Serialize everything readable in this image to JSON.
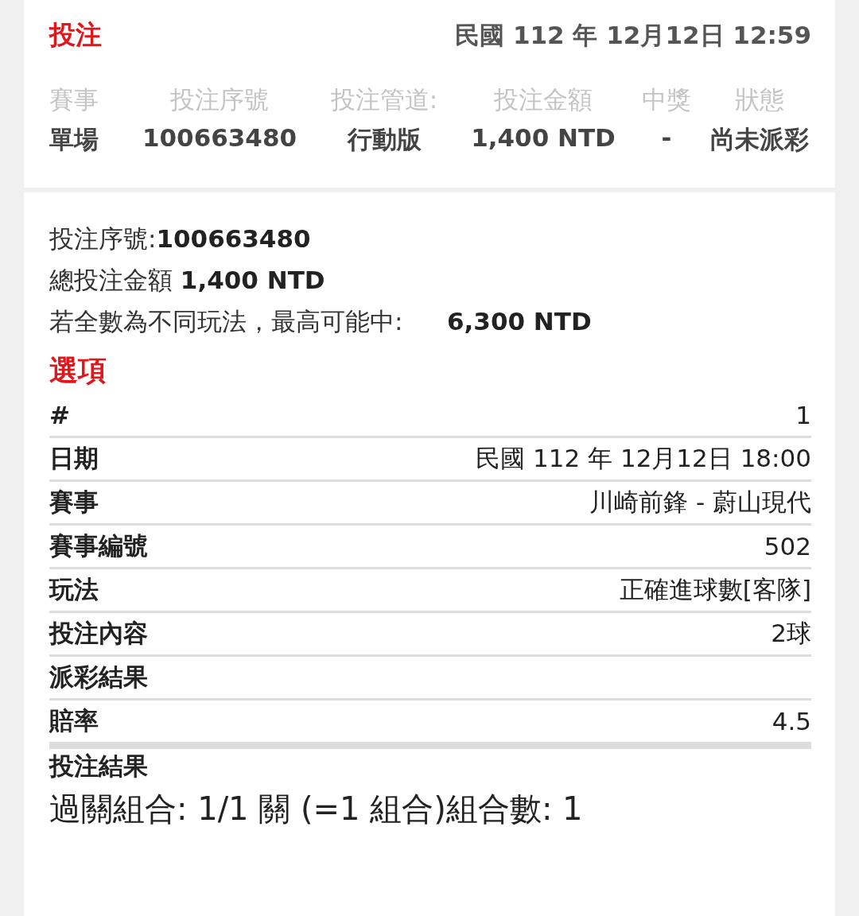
{
  "header": {
    "title": "投注",
    "datetime": "民國 112 年 12月12日 12:59"
  },
  "summary": {
    "columns": [
      "賽事",
      "投注序號",
      "投注管道:",
      "投注金額",
      "中獎",
      "狀態"
    ],
    "values": [
      "單場",
      "100663480",
      "行動版",
      "1,400 NTD",
      "-",
      "尚未派彩"
    ]
  },
  "details": {
    "lines": [
      {
        "text": "投注序號:**100663480**"
      },
      {
        "text": "總投注金額 **1,400 NTD**"
      }
    ],
    "max_win": {
      "label": "若全數為不同玩法，最高可能中:",
      "value": "6,300 NTD"
    }
  },
  "options": {
    "title": "選項",
    "rows": [
      {
        "label": "#",
        "value": "1"
      },
      {
        "label": "日期",
        "value": "民國 112 年 12月12日 18:00"
      },
      {
        "label": "賽事",
        "value": "川崎前鋒 - 蔚山現代"
      },
      {
        "label": "賽事編號",
        "value": "502"
      },
      {
        "label": "玩法",
        "value": "正確進球數[客隊]"
      },
      {
        "label": "投注內容",
        "value": "2球"
      },
      {
        "label": "派彩結果"
      },
      {
        "label": "賠率",
        "value": "4.5"
      }
    ],
    "result_label": "投注結果",
    "combination": "過關組合: 1/1 關 (=1 組合)組合數: 1"
  }
}
